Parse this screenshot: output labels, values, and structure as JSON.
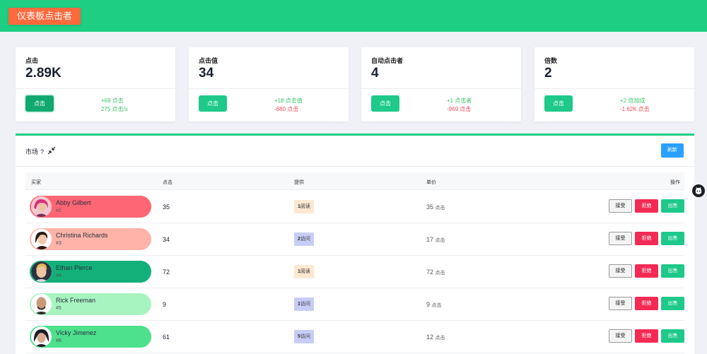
{
  "header": {
    "title": "仪表板点击者",
    "bg_color": "#1ecf83",
    "brand_color": "#ff6a3d"
  },
  "stats": [
    {
      "label": "点击",
      "value": "2.89K",
      "button": "点击",
      "line1": "+69 点击",
      "line2": "275 点击/s",
      "line2_color": "green"
    },
    {
      "label": "点击值",
      "value": "34",
      "button": "点击",
      "line1": "+18 点击值",
      "line2": "-680 点击",
      "line2_color": "red"
    },
    {
      "label": "自动点击者",
      "value": "4",
      "button": "点击",
      "line1": "+1 点击者",
      "line2": "-969 点击",
      "line2_color": "red"
    },
    {
      "label": "倍数",
      "value": "2",
      "button": "点击",
      "line1": "+2 倍加成",
      "line2": "-1.62K 点击",
      "line2_color": "red"
    }
  ],
  "market": {
    "title": "市场",
    "help": "?",
    "refresh_label": "刷新",
    "columns": {
      "buyer": "买家",
      "clicks": "点击",
      "offer": "提供",
      "unit_price": "单价",
      "actions": "操作"
    },
    "actions": {
      "accept": "接受",
      "reject": "拒绝",
      "sell": "出售"
    },
    "rows": [
      {
        "name": "Abby Gilbert",
        "id": "#2",
        "clicks": "35",
        "offer_qty": "1",
        "offer_type": "阅读",
        "offer_kind": "read",
        "price": "35",
        "price_unit": "点击",
        "color": "#ff6675",
        "avatar": "woman-pink-hair"
      },
      {
        "name": "Christina Richards",
        "id": "#3",
        "clicks": "34",
        "offer_qty": "2",
        "offer_type": "访问",
        "offer_kind": "visit",
        "price": "17",
        "price_unit": "点击",
        "color": "#ffb3a9",
        "avatar": "woman-dark-hair"
      },
      {
        "name": "Ethan Pierce",
        "id": "#4",
        "clicks": "72",
        "offer_qty": "1",
        "offer_type": "阅读",
        "offer_kind": "read",
        "price": "72",
        "price_unit": "点击",
        "color": "#14b07a",
        "avatar": "man-blond"
      },
      {
        "name": "Rick Freeman",
        "id": "#5",
        "clicks": "9",
        "offer_qty": "1",
        "offer_type": "访问",
        "offer_kind": "visit",
        "price": "9",
        "price_unit": "点击",
        "color": "#a8f4c0",
        "avatar": "man-bald"
      },
      {
        "name": "Vicky Jimenez",
        "id": "#6",
        "clicks": "61",
        "offer_qty": "5",
        "offer_type": "访问",
        "offer_kind": "visit",
        "price": "12",
        "price_unit": "点击",
        "color": "#4de08d",
        "avatar": "woman-dark-hair-2"
      }
    ]
  },
  "icons": {
    "shrink": "shrink-icon",
    "github": "github-icon"
  }
}
